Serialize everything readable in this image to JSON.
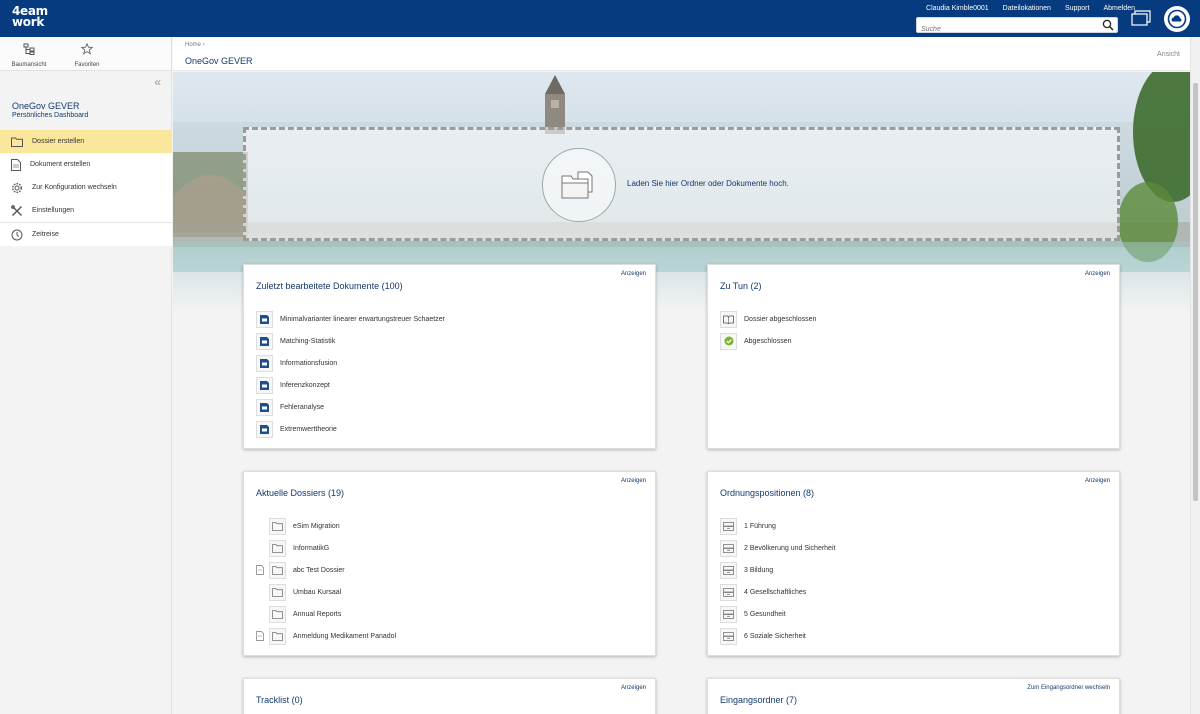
{
  "header": {
    "logo_line1": "4eam",
    "logo_line2": "work",
    "links": [
      "Claudia Kimble0001",
      "Dateilokationen",
      "Support",
      "Abmelden"
    ],
    "search_placeholder": "Suche"
  },
  "sidebar": {
    "tabs": [
      {
        "label": "Baumansicht",
        "icon": "tree-icon"
      },
      {
        "label": "Favoriten",
        "icon": "star-icon"
      }
    ],
    "collapse_glyph": "«",
    "title": "OneGov GEVER",
    "subtitle": "Persönliches Dashboard",
    "menu": [
      {
        "label": "Dossier erstellen",
        "icon": "folder-icon",
        "active": true
      },
      {
        "label": "Dokument erstellen",
        "icon": "document-icon"
      },
      {
        "label": "Zur Konfiguration wechseln",
        "icon": "gear-icon"
      },
      {
        "label": "Einstellungen",
        "icon": "tools-icon"
      },
      {
        "label": "Zeitreise",
        "icon": "clock-icon"
      }
    ]
  },
  "breadcrumb": {
    "home": "Home",
    "separator": "›"
  },
  "page": {
    "title": "OneGov GEVER",
    "view_label": "Ansicht"
  },
  "dropzone": {
    "text": "Laden Sie hier Ordner oder Dokumente hoch."
  },
  "cards": {
    "recent_docs": {
      "title": "Zuletzt bearbeitete Dokumente (100)",
      "link": "Anzeigen",
      "items": [
        "Minimalvarianter linearer erwartungstreuer Schaetzer",
        "Matching-Statistik",
        "Informationsfusion",
        "Inferenzkonzept",
        "Fehleranalyse",
        "Extremwerttheorie"
      ]
    },
    "todo": {
      "title": "Zu Tun (2)",
      "link": "Anzeigen",
      "items": [
        {
          "label": "Dossier abgeschlossen",
          "icon": "book-icon"
        },
        {
          "label": "Abgeschlossen",
          "icon": "check-icon"
        }
      ]
    },
    "dossiers": {
      "title": "Aktuelle Dossiers (19)",
      "link": "Anzeigen",
      "items": [
        {
          "label": "eSim Migration",
          "doc": false
        },
        {
          "label": "InformatikG",
          "doc": false
        },
        {
          "label": "abc Test Dossier",
          "doc": true
        },
        {
          "label": "Umbau Kursaal",
          "doc": false
        },
        {
          "label": "Annual Reports",
          "doc": false
        },
        {
          "label": "Anmeldung Medikament Panadol",
          "doc": true
        }
      ]
    },
    "positions": {
      "title": "Ordnungspositionen (8)",
      "link": "Anzeigen",
      "items": [
        "1 Führung",
        "2 Bevölkerung und Sicherheit",
        "3 Bildung",
        "4 Gesellschaftliches",
        "5 Gesundheit",
        "6 Soziale Sicherheit"
      ]
    },
    "tracklist": {
      "title": "Tracklist (0)",
      "link": "Anzeigen"
    },
    "inbox": {
      "title": "Eingangsordner (7)",
      "link": "Zum Eingangsordner wechseln"
    }
  },
  "colors": {
    "brand": "#063c7f",
    "link": "#12386e",
    "active_menu": "#fbe79b",
    "doc_icon": "#1d4f8c"
  }
}
